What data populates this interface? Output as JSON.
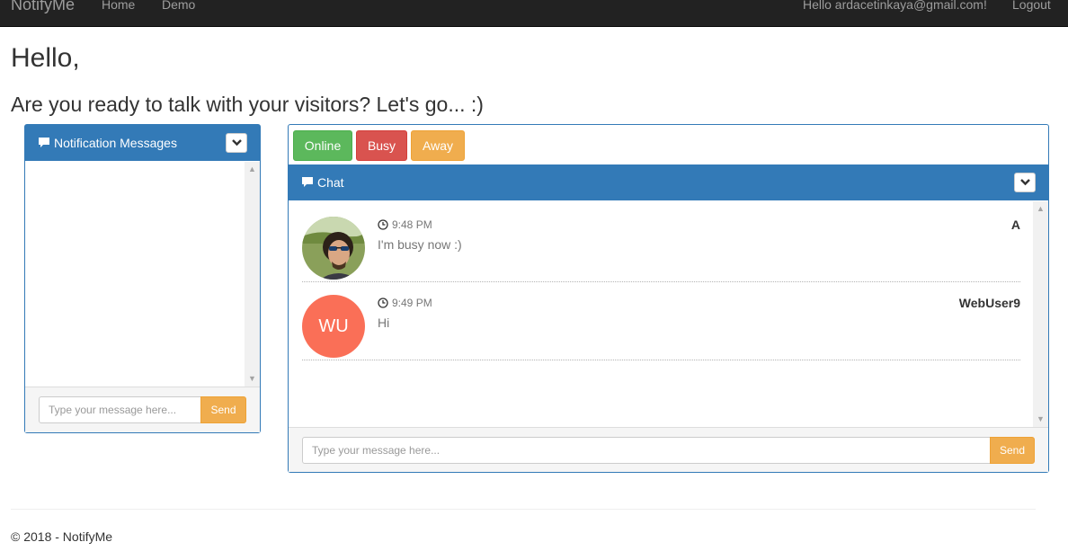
{
  "navbar": {
    "brand": "NotifyMe",
    "links": [
      "Home",
      "Demo"
    ],
    "user_greeting": "Hello ardacetinkaya@gmail.com!",
    "logout": "Logout"
  },
  "page": {
    "greeting": "Hello,",
    "subtitle": "Are you ready to talk with your visitors? Let's go... :)"
  },
  "notifications": {
    "title": "Notification Messages",
    "input_placeholder": "Type your message here...",
    "send_label": "Send"
  },
  "status": {
    "buttons": [
      "Online",
      "Busy",
      "Away"
    ],
    "colors": {
      "online": "#5cb85c",
      "busy": "#d9534f",
      "away": "#f0ad4e"
    }
  },
  "chat": {
    "title": "Chat",
    "messages": [
      {
        "time": "9:48 PM",
        "text": "I'm busy now :)",
        "author": "A",
        "avatar": "photo"
      },
      {
        "time": "9:49 PM",
        "text": "Hi",
        "author": "WebUser9",
        "avatar_initials": "WU"
      }
    ],
    "input_placeholder": "Type your message here...",
    "send_label": "Send"
  },
  "footer": {
    "text": "© 2018 - NotifyMe"
  },
  "theme": {
    "primary": "#337ab7",
    "warning": "#f0ad4e",
    "navbar": "#222222"
  }
}
